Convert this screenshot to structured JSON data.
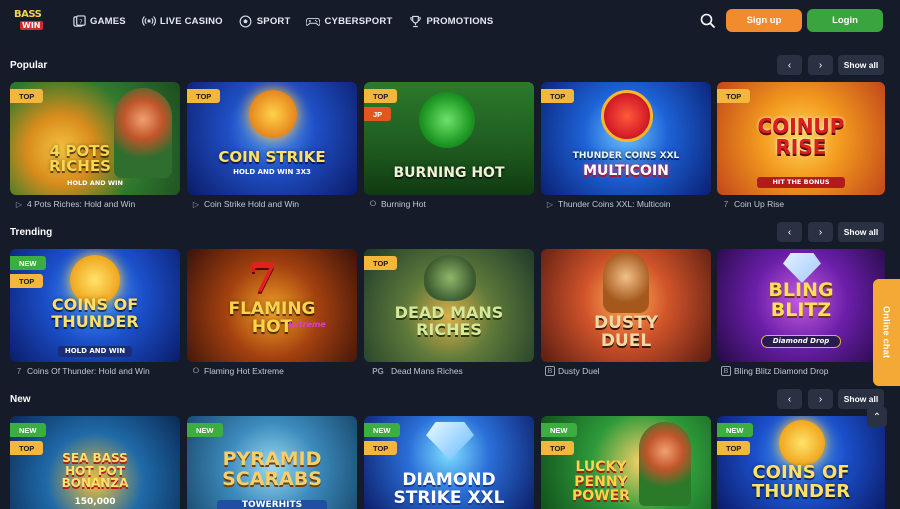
{
  "header": {
    "logo_top": "BASS",
    "logo_bottom": "WIN",
    "nav": [
      {
        "label": "GAMES",
        "icon": "games-icon"
      },
      {
        "label": "LIVE CASINO",
        "icon": "broadcast-icon"
      },
      {
        "label": "SPORT",
        "icon": "football-icon"
      },
      {
        "label": "CYBERSPORT",
        "icon": "gamepad-icon"
      },
      {
        "label": "PROMOTIONS",
        "icon": "trophy-icon"
      }
    ],
    "signup": "Sign up",
    "login": "Login"
  },
  "colors": {
    "background": "#161b2a",
    "signup": "#f28a2e",
    "login": "#3aa43f",
    "badge_top": "#f4b63b",
    "badge_new": "#3cae3f",
    "badge_jp": "#e2571f",
    "chat": "#f4a937"
  },
  "sections": [
    {
      "title": "Popular",
      "show_all": "Show all",
      "games": [
        {
          "name": "4 Pots Riches: Hold and Win",
          "badges": [
            "TOP"
          ],
          "art": "4 POTS\nRICHES",
          "art_sub": "HOLD AND WIN",
          "provider_icon": "play-icon"
        },
        {
          "name": "Coin Strike Hold and Win",
          "badges": [
            "TOP"
          ],
          "art": "COIN STRIKE",
          "art_sub": "HOLD AND WIN 3X3",
          "provider_icon": "play-icon"
        },
        {
          "name": "Burning Hot",
          "badges": [
            "TOP",
            "JP"
          ],
          "art": "BURNING HOT",
          "art_sub": "",
          "provider_icon": "egt-icon"
        },
        {
          "name": "Thunder Coins XXL: Multicoin",
          "badges": [
            "TOP"
          ],
          "art": "THUNDER COINS XXL",
          "art_sub": "MULTICOIN",
          "provider_icon": "play-icon"
        },
        {
          "name": "Coin Up Rise",
          "badges": [
            "TOP"
          ],
          "art": "COINUP\nRISE",
          "art_sub": "HIT THE BONUS",
          "provider_icon": "seven-icon"
        }
      ]
    },
    {
      "title": "Trending",
      "show_all": "Show all",
      "games": [
        {
          "name": "Coins Of Thunder: Hold and Win",
          "badges": [
            "NEW",
            "TOP"
          ],
          "art": "COINS OF\nTHUNDER",
          "art_sub": "HOLD AND WIN",
          "provider_icon": "seven-icon"
        },
        {
          "name": "Flaming Hot Extreme",
          "badges": [],
          "art": "FLAMING\nHOT",
          "art_sub": "Extreme",
          "provider_icon": "egt-icon"
        },
        {
          "name": "Dead Mans Riches",
          "badges": [
            "TOP"
          ],
          "art": "DEAD MANS\nRICHES",
          "art_sub": "",
          "provider_icon": "pg-icon"
        },
        {
          "name": "Dusty Duel",
          "badges": [],
          "art": "DUSTY\nDUEL",
          "art_sub": "",
          "provider_icon": "b-icon"
        },
        {
          "name": "Bling Blitz Diamond Drop",
          "badges": [],
          "art": "BLING\nBLITZ",
          "art_sub": "Diamond Drop",
          "provider_icon": "b-icon"
        }
      ]
    },
    {
      "title": "New",
      "show_all": "Show all",
      "games": [
        {
          "name": "Sea Bass Hot Pot Bonanza",
          "badges": [
            "NEW",
            "TOP"
          ],
          "art": "SEA BASS\nHOT POT\nBONANZA",
          "art_sub": "150,000",
          "provider_icon": ""
        },
        {
          "name": "Pyramid Scarabs",
          "badges": [
            "NEW"
          ],
          "art": "PYRAMID\nSCARABS",
          "art_sub": "TOWERHITS",
          "provider_icon": ""
        },
        {
          "name": "Diamond Strike XXL",
          "badges": [
            "NEW",
            "TOP"
          ],
          "art": "DIAMOND\nSTRIKE XXL",
          "art_sub": "",
          "provider_icon": ""
        },
        {
          "name": "Lucky Penny Power",
          "badges": [
            "NEW",
            "TOP"
          ],
          "art": "LUCKY\nPENNY\nPOWER",
          "art_sub": "",
          "provider_icon": ""
        },
        {
          "name": "Coins Of Thunder",
          "badges": [
            "NEW",
            "TOP"
          ],
          "art": "COINS OF\nTHUNDER",
          "art_sub": "",
          "provider_icon": ""
        }
      ]
    }
  ],
  "online_chat": "Online chat"
}
